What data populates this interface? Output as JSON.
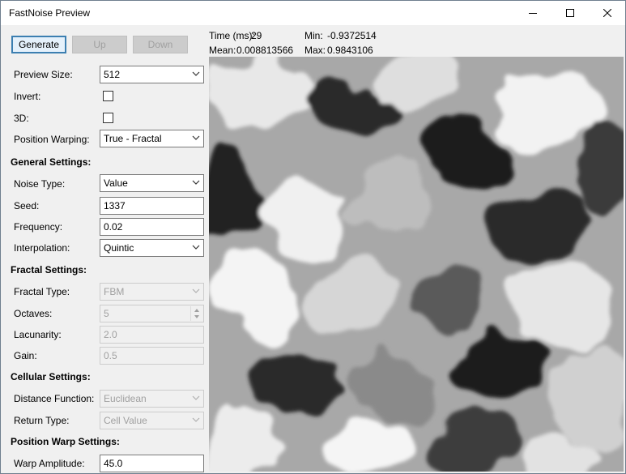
{
  "window": {
    "title": "FastNoise Preview"
  },
  "toolbar": {
    "generate": "Generate",
    "up": "Up",
    "down": "Down"
  },
  "stats": {
    "time_label": "Time (ms):",
    "time": "29",
    "mean_label": "Mean:",
    "mean": "0.008813566",
    "min_label": "Min:",
    "min": "-0.9372514",
    "max_label": "Max:",
    "max": "0.9843106"
  },
  "settings": {
    "preview_size": {
      "label": "Preview Size:",
      "value": "512"
    },
    "invert": {
      "label": "Invert:",
      "checked": false
    },
    "three_d": {
      "label": "3D:",
      "checked": false
    },
    "position_warping": {
      "label": "Position Warping:",
      "value": "True - Fractal"
    }
  },
  "general": {
    "heading": "General Settings:",
    "noise_type": {
      "label": "Noise Type:",
      "value": "Value"
    },
    "seed": {
      "label": "Seed:",
      "value": "1337"
    },
    "frequency": {
      "label": "Frequency:",
      "value": "0.02"
    },
    "interpolation": {
      "label": "Interpolation:",
      "value": "Quintic"
    }
  },
  "fractal": {
    "heading": "Fractal Settings:",
    "type": {
      "label": "Fractal Type:",
      "value": "FBM"
    },
    "octaves": {
      "label": "Octaves:",
      "value": "5"
    },
    "lacunarity": {
      "label": "Lacunarity:",
      "value": "2.0"
    },
    "gain": {
      "label": "Gain:",
      "value": "0.5"
    }
  },
  "cellular": {
    "heading": "Cellular Settings:",
    "distance_function": {
      "label": "Distance Function:",
      "value": "Euclidean"
    },
    "return_type": {
      "label": "Return Type:",
      "value": "Cell Value"
    }
  },
  "warp": {
    "heading": "Position Warp Settings:",
    "amplitude": {
      "label": "Warp Amplitude:",
      "value": "45.0"
    }
  },
  "icons": {
    "minimize": "minimize-icon",
    "maximize": "maximize-icon",
    "close": "close-icon",
    "dropdown": "chevron-down-icon",
    "spin_up": "spin-up-icon",
    "spin_down": "spin-down-icon"
  },
  "colors": {
    "accent": "#3c7fb1",
    "button_face": "#e1e1e1",
    "disabled_text": "#a0a0a0"
  }
}
